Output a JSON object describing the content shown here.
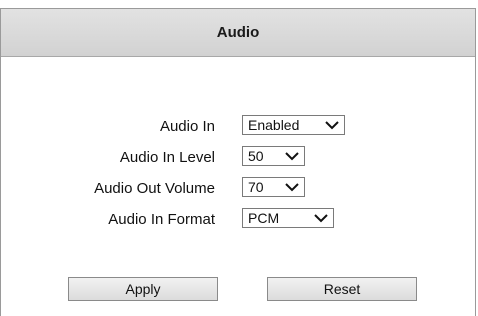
{
  "header": {
    "title": "Audio"
  },
  "fields": [
    {
      "label": "Audio In",
      "value": "Enabled"
    },
    {
      "label": "Audio In Level",
      "value": "50"
    },
    {
      "label": "Audio Out Volume",
      "value": "70"
    },
    {
      "label": "Audio In Format",
      "value": "PCM"
    }
  ],
  "buttons": {
    "apply": "Apply",
    "reset": "Reset"
  },
  "icons": {
    "dropdown": "chevron-down-icon"
  }
}
